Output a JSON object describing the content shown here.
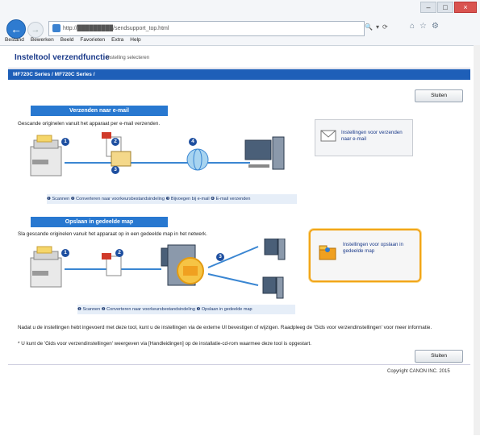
{
  "browser": {
    "window_buttons": [
      "–",
      "□",
      "×"
    ],
    "url": "http://█████████/sendsupport_top.html",
    "nav_right": [
      "🔍",
      "▾",
      "⟳"
    ],
    "toolbar_icons": [
      "⌂",
      "☆",
      "⚙"
    ],
    "menu": [
      "Bestand",
      "Bewerken",
      "Beeld",
      "Favorieten",
      "Extra",
      "Help"
    ]
  },
  "page": {
    "app_title": "Insteltool verzendfunctie",
    "subtitle": "Instelling selecteren",
    "breadcrumb": "MF720C Series / MF720C Series /",
    "close_label": "Sluiten",
    "email": {
      "heading": "Verzenden naar e-mail",
      "description": "Gescande originelen vanuit het apparaat per e-mail verzenden.",
      "steps": [
        "1",
        "2",
        "3",
        "4"
      ],
      "legend": "❶ Scannen ❷ Converteren naar voorkeursbestandsindeling ❸ Bijvoegen bij e-mail ❹ E-mail verzenden",
      "card_label": "Instellingen voor verzenden naar e-mail"
    },
    "folder": {
      "heading": "Opslaan in gedeelde map",
      "description": "Sla gescande originelen vanuit het apparaat op in een gedeelde map in het netwerk.",
      "steps": [
        "1",
        "2",
        "3"
      ],
      "legend": "❶ Scannen ❷ Converteren naar voorkeursbestandsindeling ❸ Opslaan in gedeelde map",
      "card_label": "Instellingen voor opslaan in gedeelde map"
    },
    "footer_text_1": "Nadat u de instellingen hebt ingevoerd met deze tool, kunt u de instellingen via de externe UI bevestigen of wijzigen. Raadpleeg de 'Gids voor verzendinstellingen' voor meer informatie.",
    "footer_text_2": "* U kunt de 'Gids voor verzendinstellingen' weergeven via [Handleidingen] op de installatie-cd-rom waarmee deze tool is opgestart.",
    "copyright": "Copyright CANON INC. 2015"
  }
}
